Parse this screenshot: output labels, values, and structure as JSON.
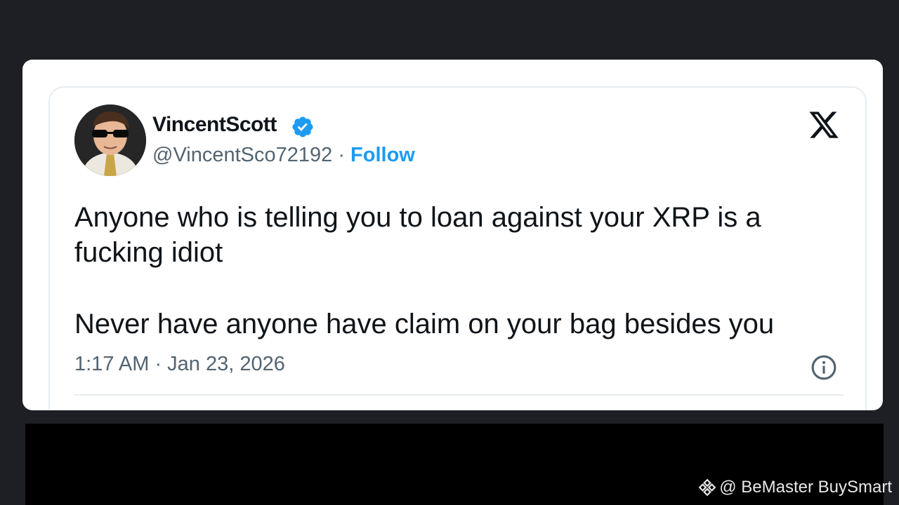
{
  "tweet": {
    "display_name": "VincentScott",
    "handle": "@VincentSco72192",
    "separator": " · ",
    "follow_label": "Follow",
    "paragraphs": [
      "Anyone who is telling you to loan against your XRP is a fucking idiot",
      "Never have anyone have claim on your bag besides you"
    ],
    "timestamp": "1:17 AM · Jan 23, 2026",
    "icons": {
      "verified": "verified-badge-icon",
      "platform": "x-logo-icon",
      "info": "info-icon"
    }
  },
  "watermark": {
    "text": "@ BeMaster BuySmart",
    "icon": "binance-diamond-icon"
  },
  "colors": {
    "background": "#1d1f25",
    "follow_blue": "#1d9bf0",
    "text": "#0f1419",
    "muted": "#536471"
  }
}
